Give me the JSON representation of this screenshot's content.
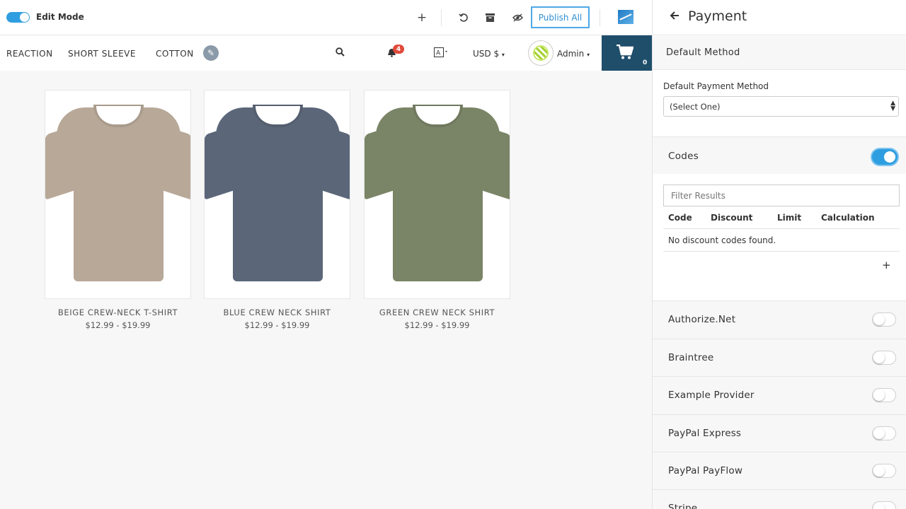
{
  "admin_bar": {
    "edit_mode_label": "Edit Mode",
    "publish_label": "Publish All",
    "icons": [
      "plus-icon",
      "undo-icon",
      "archive-icon",
      "visibility-icon"
    ]
  },
  "nav": {
    "tags": [
      "REACTION",
      "SHORT SLEEVE",
      "COTTON"
    ],
    "notification_count": "4",
    "currency": "USD $",
    "user": "Admin",
    "cart_count": "0"
  },
  "products": [
    {
      "title": "BEIGE CREW-NECK T-SHIRT",
      "price": "$12.99 - $19.99",
      "color": "#b8a898"
    },
    {
      "title": "BLUE CREW NECK SHIRT",
      "price": "$12.99 - $19.99",
      "color": "#5b6679"
    },
    {
      "title": "GREEN CREW NECK SHIRT",
      "price": "$12.99 - $19.99",
      "color": "#7a8466"
    }
  ],
  "sidebar": {
    "title": "Payment",
    "default_method": {
      "section_title": "Default Method",
      "field_label": "Default Payment Method",
      "selected": "(Select One)"
    },
    "codes": {
      "section_title": "Codes",
      "enabled": true,
      "filter_placeholder": "Filter Results",
      "columns": [
        "Code",
        "Discount",
        "Limit",
        "Calculation"
      ],
      "empty_message": "No discount codes found."
    },
    "providers": [
      {
        "label": "Authorize.Net",
        "enabled": false
      },
      {
        "label": "Braintree",
        "enabled": false
      },
      {
        "label": "Example Provider",
        "enabled": false
      },
      {
        "label": "PayPal Express",
        "enabled": false
      },
      {
        "label": "PayPal PayFlow",
        "enabled": false
      },
      {
        "label": "Stripe",
        "enabled": false
      }
    ]
  },
  "colors": {
    "accent": "#2f9ee0",
    "cart_bg": "#1f4e6b",
    "badge": "#e04a3a"
  }
}
